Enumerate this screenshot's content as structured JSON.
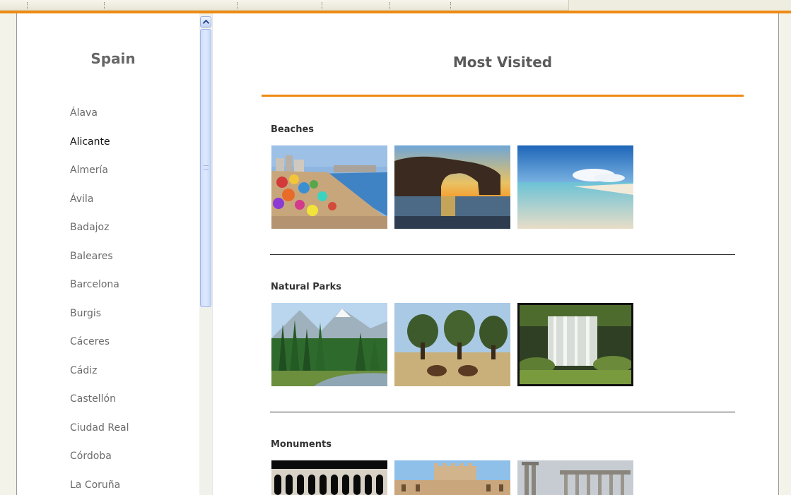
{
  "sidebar": {
    "title": "Spain",
    "provinces": [
      "Álava",
      "Alicante",
      "Almería",
      "Ávila",
      "Badajoz",
      "Baleares",
      "Barcelona",
      "Burgis",
      "Cáceres",
      "Cádiz",
      "Castellón",
      "Ciudad Real",
      "Córdoba",
      "La Coruña"
    ],
    "active_province": "Alicante"
  },
  "main": {
    "title": "Most Visited",
    "sections": [
      {
        "heading": "Beaches"
      },
      {
        "heading": "Natural Parks"
      },
      {
        "heading": "Monuments"
      }
    ]
  },
  "colors": {
    "accent": "#ee8a12",
    "text": "#6b6b6b"
  },
  "icons": {
    "scroll_up": "chevron-up-icon"
  }
}
